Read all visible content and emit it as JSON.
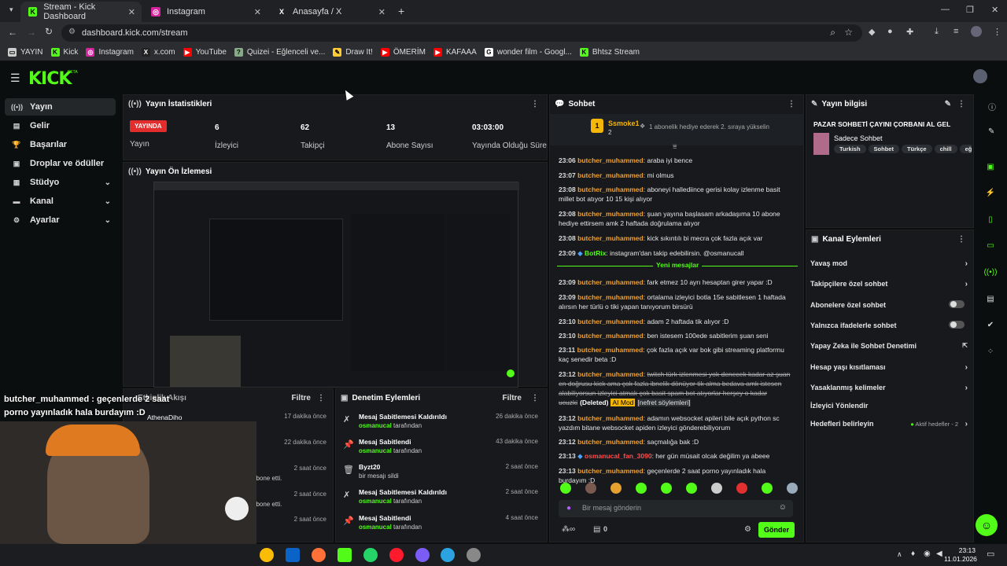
{
  "browser": {
    "tabs": [
      {
        "title": "Stream - Kick Dashboard",
        "icon": "kick-icon"
      },
      {
        "title": "Instagram",
        "icon": "instagram-icon"
      },
      {
        "title": "Anasayfa / X",
        "icon": "x-icon"
      }
    ],
    "url": "dashboard.kick.com/stream",
    "bookmarks": [
      "YAYIN",
      "Kick",
      "Instagram",
      "x.com",
      "YouTube",
      "Quizei - Eğlenceli ve...",
      "Draw It!",
      "ÖMERİM",
      "KAFAAA",
      "wonder film - Googl...",
      "Bhtsz Stream"
    ]
  },
  "app": {
    "logo": "KICK",
    "logo_badge": "BETA"
  },
  "sidebar": {
    "items": [
      {
        "label": "Yayın",
        "icon": "broadcast-icon"
      },
      {
        "label": "Gelir",
        "icon": "revenue-icon"
      },
      {
        "label": "Başarılar",
        "icon": "trophy-icon"
      },
      {
        "label": "Droplar ve ödüller",
        "icon": "gift-icon"
      },
      {
        "label": "Stüdyo",
        "icon": "studio-icon"
      },
      {
        "label": "Kanal",
        "icon": "channel-icon"
      },
      {
        "label": "Ayarlar",
        "icon": "gear-icon"
      }
    ]
  },
  "stats": {
    "title": "Yayın İstatistikleri",
    "live_badge": "YAYINDA",
    "items": [
      {
        "value": "6",
        "label": "İzleyici"
      },
      {
        "value": "62",
        "label": "Takipçi"
      },
      {
        "value": "13",
        "label": "Abone Sayısı"
      },
      {
        "value": "03:03:00",
        "label": "Yayında Olduğu Süre"
      }
    ],
    "yayin_label": "Yayın"
  },
  "preview": {
    "title": "Yayın Ön İzlemesi"
  },
  "overlay": {
    "chat_msg_line1": "butcher_muhammed : geçenlerde 2 saat",
    "chat_msg_line2": "porno yayınladık hala burdayım :D",
    "activity_title": "Etkinlik Akışı",
    "activity_user": "AthenaDiho",
    "filter": "Filtre",
    "activity_times": [
      "17 dakika önce",
      "22 dakika önce",
      "2 saat önce",
      "2 saat önce",
      "2 saat önce"
    ],
    "activity_snips": [
      "abone etti.",
      "abone etti."
    ]
  },
  "moderation": {
    "title": "Denetim Eylemleri",
    "filter": "Filtre",
    "items": [
      {
        "title": "Mesaj Sabitlemesi Kaldırıldı",
        "user": "osmanucal",
        "suffix": "tarafından",
        "time": "26 dakika önce",
        "icon": "unpin-icon"
      },
      {
        "title": "Mesaj Sabitlendi",
        "user": "osmanucal",
        "suffix": "tarafından",
        "time": "43 dakika önce",
        "icon": "pin-icon"
      },
      {
        "title": "Byzt20",
        "user": "",
        "suffix": "bir mesajı sildi",
        "time": "2 saat önce",
        "icon": "trash-icon"
      },
      {
        "title": "Mesaj Sabitlemesi Kaldırıldı",
        "user": "osmanucal",
        "suffix": "tarafından",
        "time": "2 saat önce",
        "icon": "unpin-icon"
      },
      {
        "title": "Mesaj Sabitlendi",
        "user": "osmanucal",
        "suffix": "tarafından",
        "time": "4 saat önce",
        "icon": "pin-icon"
      }
    ]
  },
  "chat": {
    "title": "Sohbet",
    "pinned_user": "Ssmoke1",
    "pinned_count": "2",
    "pinned_text": "1 abonelik hediye ederek 2. sıraya yükselin",
    "new_messages": "Yeni mesajlar",
    "messages": [
      {
        "t": "23:06",
        "u": "butcher_muhammed",
        "m": "araba iyi bence"
      },
      {
        "t": "23:07",
        "u": "butcher_muhammed",
        "m": "mi olmus"
      },
      {
        "t": "23:08",
        "u": "butcher_muhammed",
        "m": "aboneyi hallediince gerisi kolay izlenme basit millet bot atıyor 10 15 kişi alıyor"
      },
      {
        "t": "23:08",
        "u": "butcher_muhammed",
        "m": "şuan yayına başlasam arkadaşıma 10 abone hediye ettirsem amk 2 haftada doğrulama alıyor"
      },
      {
        "t": "23:08",
        "u": "butcher_muhammed",
        "m": "kick sıkıntılı bi mecra çok fazla açık var"
      },
      {
        "t": "23:09",
        "u": "BotRix",
        "m": "instagram'dan takip edebilirsin. @osmanucall"
      },
      {
        "t": "23:09",
        "u": "butcher_muhammed",
        "m": "fark etmez 10 ayrı hesaptan girer yapar :D"
      },
      {
        "t": "23:09",
        "u": "butcher_muhammed",
        "m": "ortalama izleyici botla 15e sabitlesen 1 haftada alırsın her türlü o tiki yapan tanıyorum birsürü"
      },
      {
        "t": "23:10",
        "u": "butcher_muhammed",
        "m": "adam 2 haftada tik alıyor :D"
      },
      {
        "t": "23:10",
        "u": "butcher_muhammed",
        "m": "ben istesem 100ede sabitlerim şuan seni"
      },
      {
        "t": "23:11",
        "u": "butcher_muhammed",
        "m": "çok fazla açık var bok gibi streaming platformu kaç senedir beta :D"
      },
      {
        "t": "23:12",
        "u": "butcher_muhammed",
        "m": "twitch türk izlenmesi yok denecek kadar az şuan en doğrusu kick ama çok fazla ibnelik dönüyor tik alma bedava amk istesen alabiliyorsun izleyici atmak çok basit spam bot atıyorlar herşey o kadar ucuzki"
      },
      {
        "t": "23:12",
        "u": "butcher_muhammed",
        "m": "adamın websocket apileri bile açık python sc yazdım bitane websocket apiden izleyici gönderebiliyorum"
      },
      {
        "t": "23:12",
        "u": "butcher_muhammed",
        "m": "saçmalığa bak :D"
      },
      {
        "t": "23:13",
        "u": "osmanucal_fan_3090",
        "m": "her gün müsait olcak değilim ya abeee"
      },
      {
        "t": "23:13",
        "u": "butcher_muhammed",
        "m": "geçenlerde 2 saat porno yayınladık hala burdayım :D"
      }
    ],
    "deleted_tag": "(Deleted)",
    "ai_tag": "AI Mod",
    "hate_tag": "[nefret söylemleri]",
    "input_placeholder": "Bir mesaj gönderin",
    "send_label": "Gönder",
    "viewer_count": "0"
  },
  "stream_info": {
    "title": "Yayın bilgisi",
    "stream_title": "PAZAR SOHBETİ ÇAYINI ÇORBANI AL GEL",
    "category": "Sadece Sohbet",
    "tags": [
      "Turkish",
      "Sohbet",
      "Türkçe",
      "chill",
      "eğlen"
    ]
  },
  "channel_actions": {
    "title": "Kanal Eylemleri",
    "items": [
      {
        "label": "Yavaş mod",
        "control": "arrow"
      },
      {
        "label": "Takipçilere özel sohbet",
        "control": "arrow"
      },
      {
        "label": "Abonelere özel sohbet",
        "control": "toggle"
      },
      {
        "label": "Yalnızca ifadelerle sohbet",
        "control": "toggle"
      },
      {
        "label": "Yapay Zeka ile Sohbet Denetimi",
        "control": "external"
      },
      {
        "label": "Hesap yaşı kısıtlaması",
        "control": "arrow"
      },
      {
        "label": "Yasaklanmış kelimeler",
        "control": "arrow"
      },
      {
        "label": "İzleyici Yönlendir",
        "control": "none"
      },
      {
        "label": "Hedefleri belirleyin",
        "control": "arrow"
      }
    ],
    "goals_status": "Aktif hedefler - 2"
  },
  "taskbar": {
    "time": "23:13",
    "date": "11.01.2026"
  },
  "colors": {
    "accent": "#53fc18",
    "live": "#e32d2d",
    "username": "#f0a030"
  }
}
